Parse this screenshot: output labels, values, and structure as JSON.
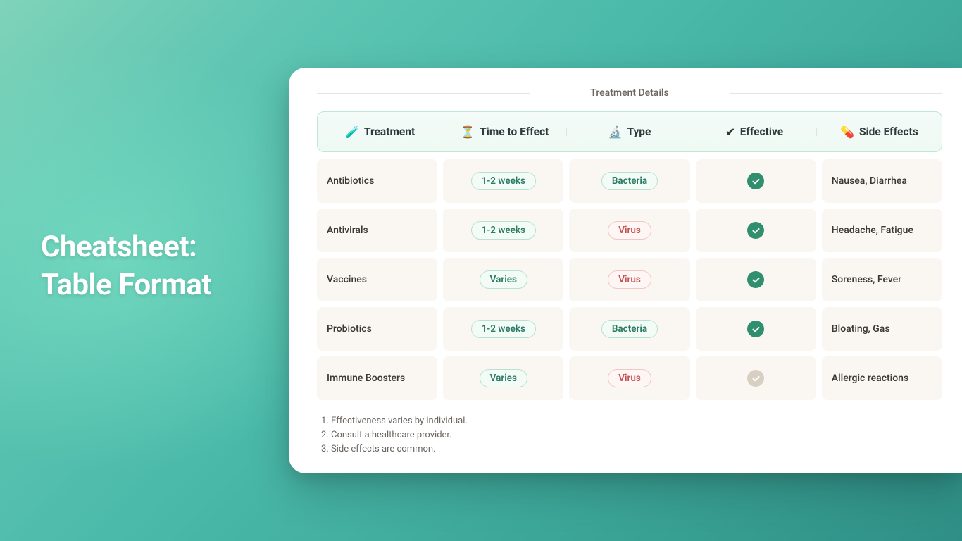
{
  "hero": {
    "line1": "Cheatsheet:",
    "line2": "Table Format"
  },
  "panel_title": "Treatment Details",
  "columns": [
    {
      "icon": "🧪",
      "label": "Treatment"
    },
    {
      "icon": "⏳",
      "label": "Time to Effect"
    },
    {
      "icon": "🔬",
      "label": "Type"
    },
    {
      "icon": "✔",
      "label": "Effective"
    },
    {
      "icon": "💊",
      "label": "Side Effects"
    }
  ],
  "rows": [
    {
      "treatment": "Antibiotics",
      "time": "1-2 weeks",
      "type": "Bacteria",
      "effective": true,
      "side_effects": "Nausea, Diarrhea"
    },
    {
      "treatment": "Antivirals",
      "time": "1-2 weeks",
      "type": "Virus",
      "effective": true,
      "side_effects": "Headache, Fatigue"
    },
    {
      "treatment": "Vaccines",
      "time": "Varies",
      "type": "Virus",
      "effective": true,
      "side_effects": "Soreness, Fever"
    },
    {
      "treatment": "Probiotics",
      "time": "1-2 weeks",
      "type": "Bacteria",
      "effective": true,
      "side_effects": "Bloating, Gas"
    },
    {
      "treatment": "Immune Boosters",
      "time": "Varies",
      "type": "Virus",
      "effective": false,
      "side_effects": "Allergic reactions"
    }
  ],
  "notes": [
    "Effectiveness varies by individual.",
    "Consult a healthcare provider.",
    "Side effects are common."
  ],
  "colors": {
    "bacteria_pill": "green",
    "virus_pill": "red",
    "time_pill": "green"
  }
}
